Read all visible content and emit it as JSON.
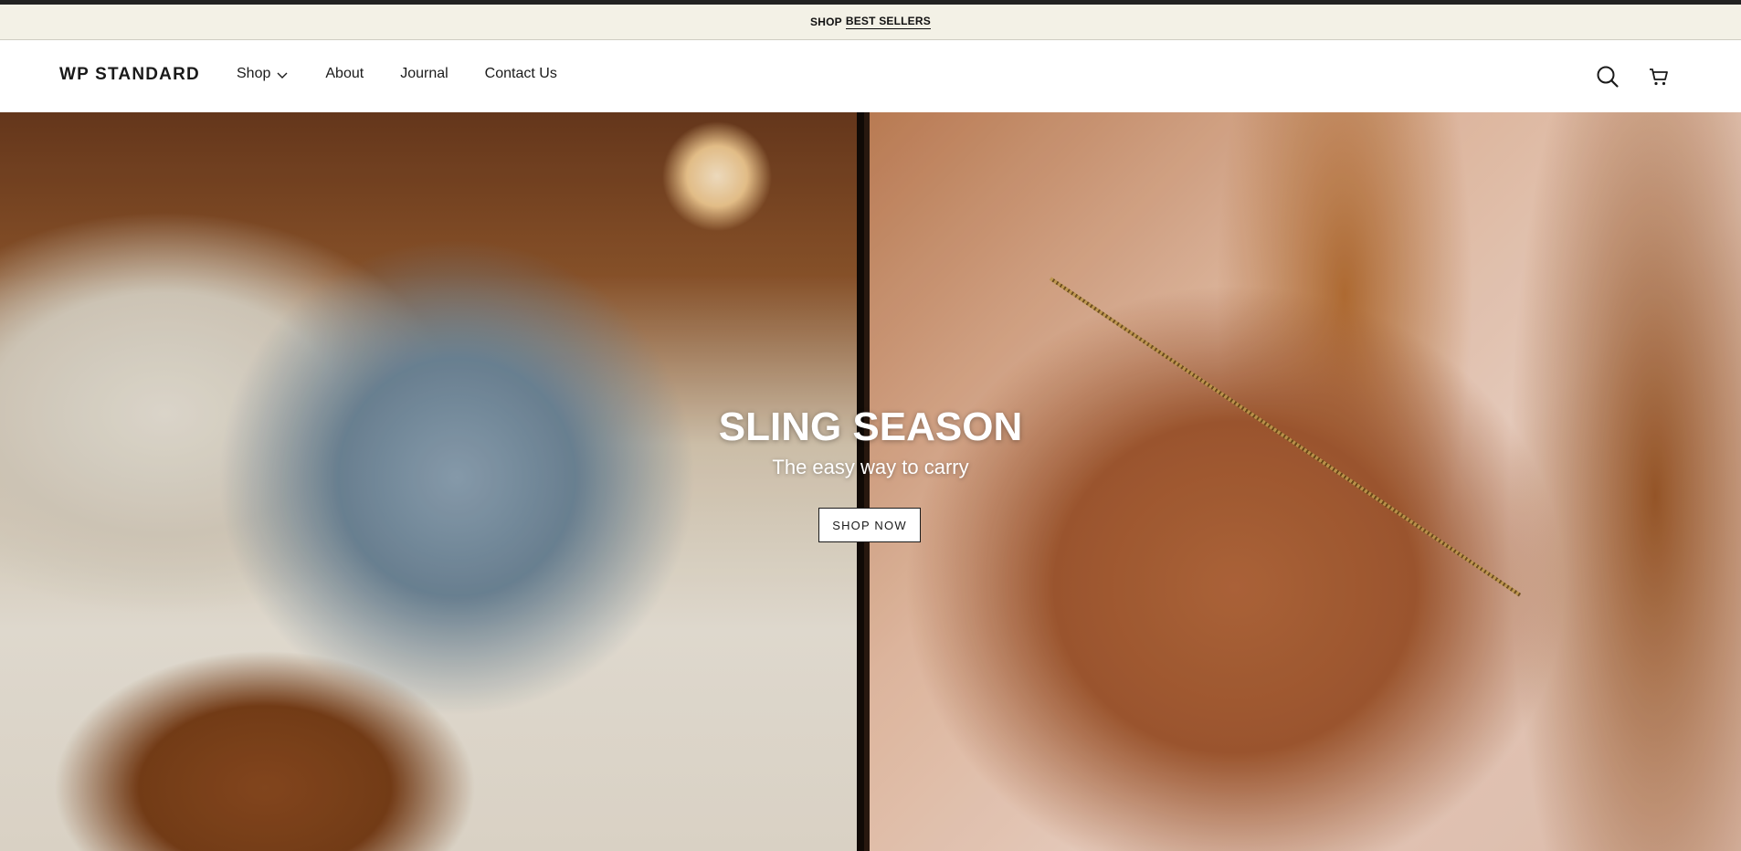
{
  "announcement": {
    "prefix": "SHOP",
    "link_text": "BEST SELLERS"
  },
  "header": {
    "logo": "WP STANDARD",
    "nav": [
      {
        "label": "Shop",
        "has_dropdown": true
      },
      {
        "label": "About"
      },
      {
        "label": "Journal"
      },
      {
        "label": "Contact Us"
      }
    ],
    "icons": [
      "search-icon",
      "cart-icon"
    ]
  },
  "hero": {
    "title": "SLING SEASON",
    "subtitle": "The easy way to carry",
    "cta_label": "SHOP NOW"
  },
  "colors": {
    "announcement_bg": "#f3f1e6",
    "text": "#1a1a1a",
    "hero_text": "#ffffff"
  }
}
